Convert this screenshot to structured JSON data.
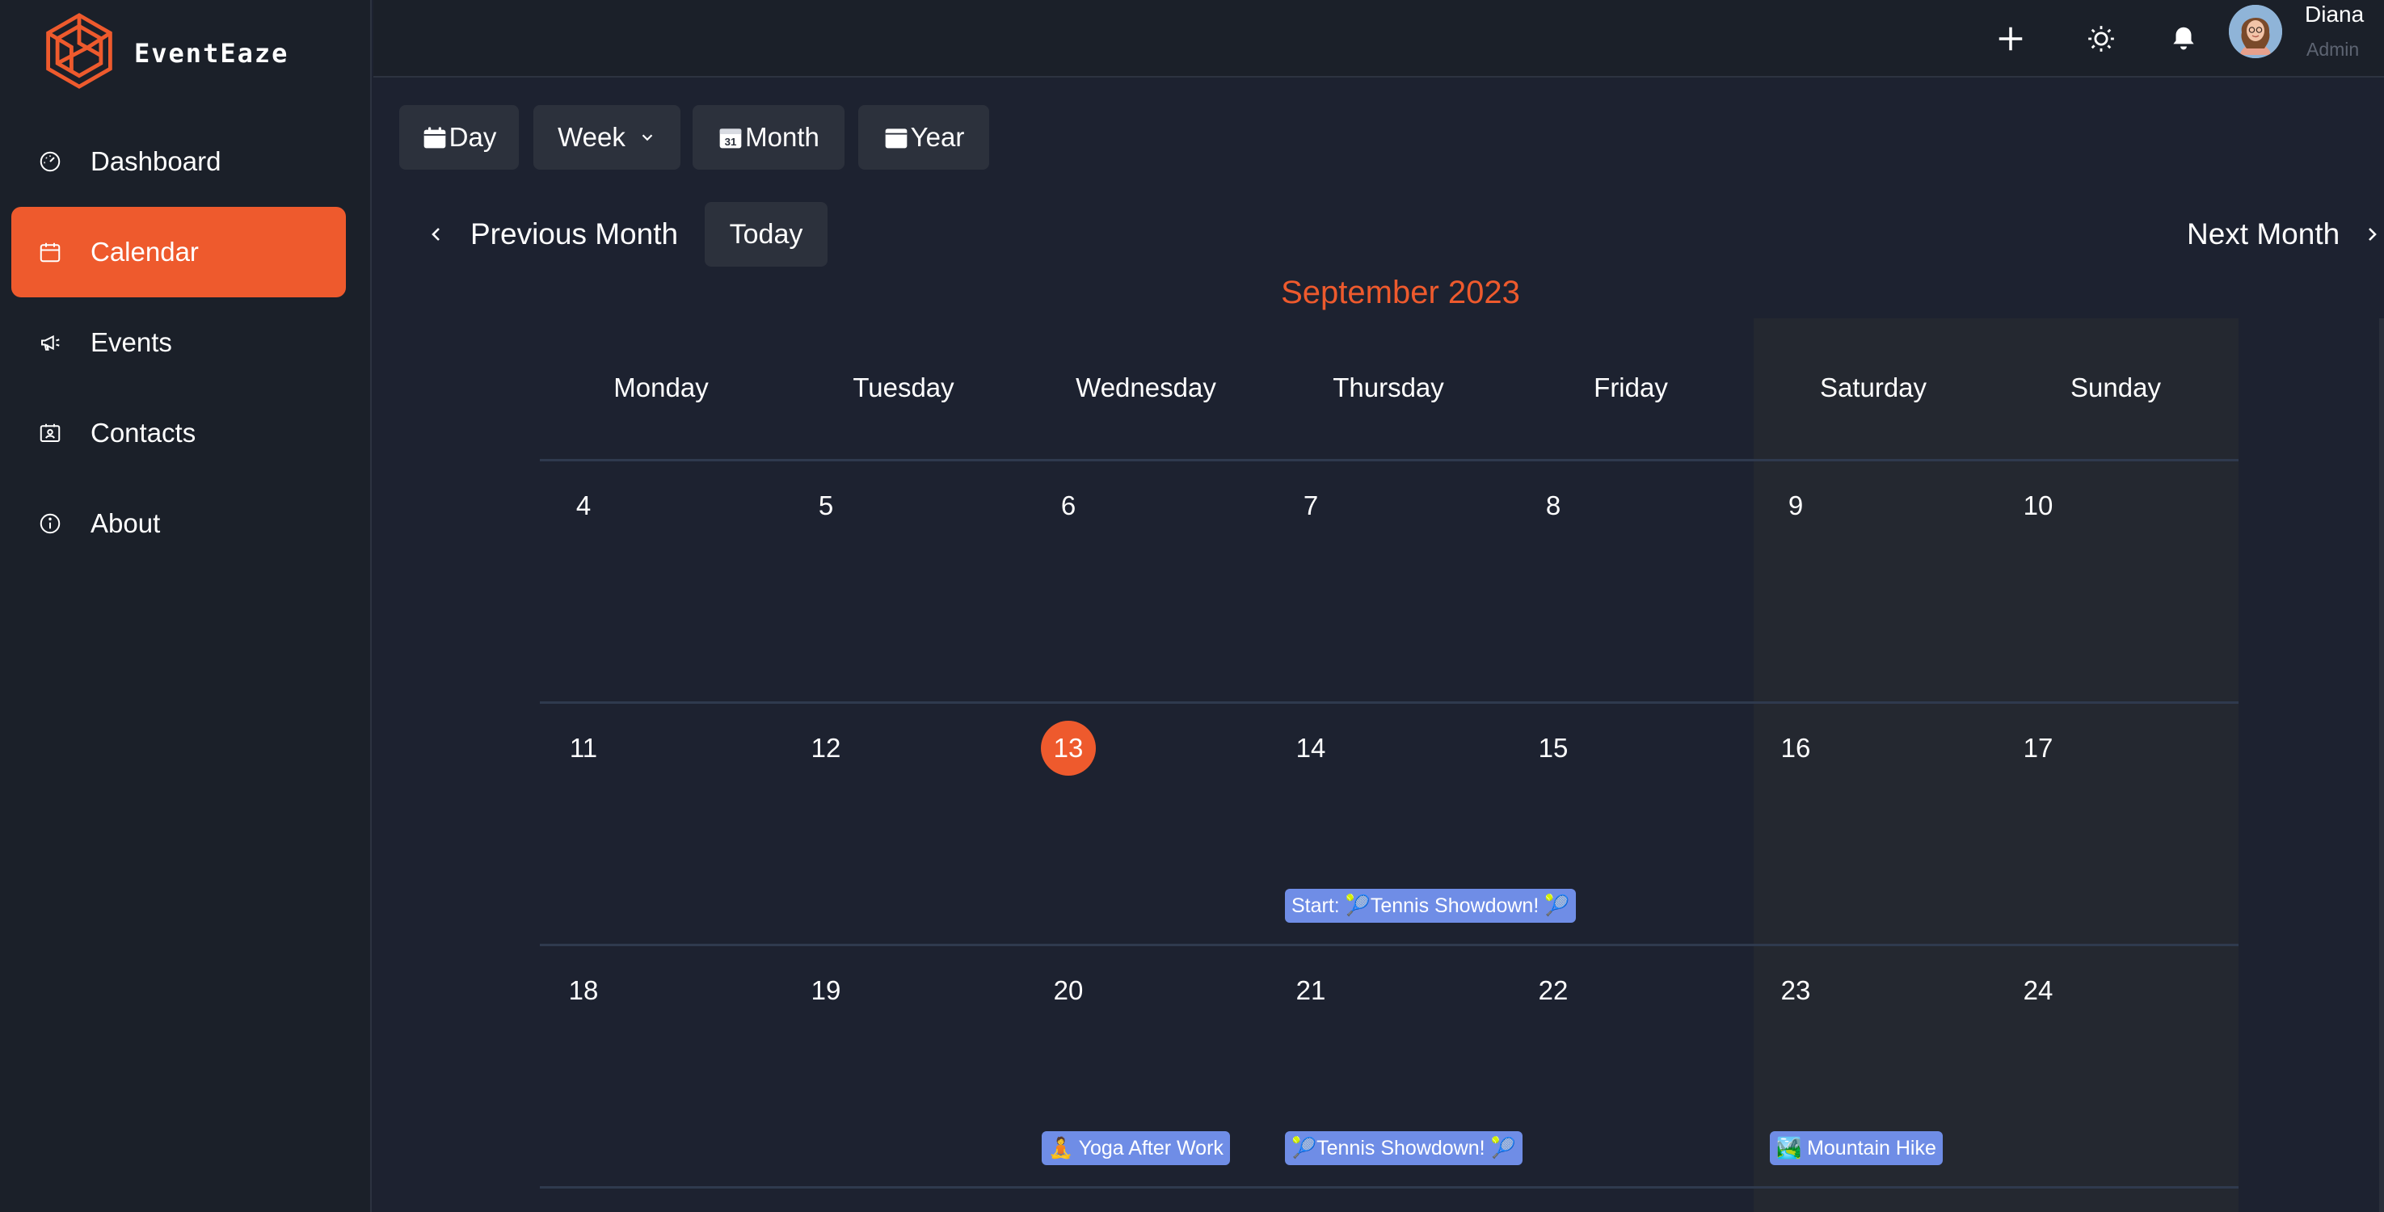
{
  "app": {
    "name": "EventEaze",
    "accent": "#ee5a2d",
    "event_color": "#6f8de6"
  },
  "sidebar": {
    "items": [
      {
        "label": "Dashboard",
        "icon": "gauge-icon",
        "active": false
      },
      {
        "label": "Calendar",
        "icon": "calendar-icon",
        "active": true
      },
      {
        "label": "Events",
        "icon": "megaphone-icon",
        "active": false
      },
      {
        "label": "Contacts",
        "icon": "contact-card-icon",
        "active": false
      },
      {
        "label": "About",
        "icon": "info-icon",
        "active": false
      }
    ]
  },
  "topbar": {
    "icons": [
      "plus-icon",
      "sun-icon",
      "bell-icon"
    ],
    "user": {
      "name": "Diana",
      "role": "Admin"
    }
  },
  "views": {
    "day": "Day",
    "week": "Week",
    "month": "Month",
    "year": "Year"
  },
  "navigation": {
    "previous": "Previous Month",
    "today": "Today",
    "next": "Next Month"
  },
  "calendar": {
    "month_label": "September 2023",
    "weekdays": [
      "Monday",
      "Tuesday",
      "Wednesday",
      "Thursday",
      "Friday",
      "Saturday",
      "Sunday"
    ],
    "weeks": [
      [
        "4",
        "5",
        "6",
        "7",
        "8",
        "9",
        "10"
      ],
      [
        "11",
        "12",
        "13",
        "14",
        "15",
        "16",
        "17"
      ],
      [
        "18",
        "19",
        "20",
        "21",
        "22",
        "23",
        "24"
      ]
    ],
    "today": "13",
    "events": [
      {
        "week": 1,
        "day": 3,
        "title": "Start: 🎾Tennis Showdown! 🎾"
      },
      {
        "week": 2,
        "day": 2,
        "title": "🧘 Yoga After Work"
      },
      {
        "week": 2,
        "day": 3,
        "title": "🎾Tennis Showdown! 🎾"
      },
      {
        "week": 2,
        "day": 5,
        "title": "🏞️ Mountain Hike"
      }
    ]
  }
}
